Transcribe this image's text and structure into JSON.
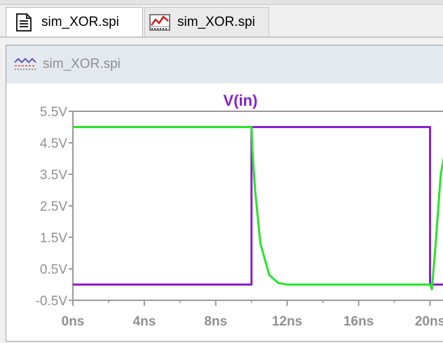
{
  "tabs": [
    {
      "label": "sim_XOR.spi",
      "icon": "netlist-document-icon",
      "active": true
    },
    {
      "label": "sim_XOR.spi",
      "icon": "waveform-icon",
      "active": false
    }
  ],
  "window": {
    "title": "sim_XOR.spi",
    "icon": "waveform-window-icon"
  },
  "colors": {
    "trace_in": "#8a1ed0",
    "trace_out": "#28e428",
    "axis": "#9a9a9a",
    "title": "#8a1ed0",
    "tick_label": "#909090"
  },
  "chart_data": {
    "type": "line",
    "title": "V(in)",
    "xlabel": "",
    "ylabel": "",
    "xlim": [
      0,
      21
    ],
    "ylim": [
      -0.5,
      5.5
    ],
    "x_ticks": [
      "0ns",
      "4ns",
      "8ns",
      "12ns",
      "16ns",
      "20ns"
    ],
    "x_tick_values": [
      0,
      4,
      8,
      12,
      16,
      20
    ],
    "y_ticks": [
      "5.5V",
      "4.5V",
      "3.5V",
      "2.5V",
      "1.5V",
      "0.5V",
      "-0.5V"
    ],
    "y_tick_values": [
      5.5,
      4.5,
      3.5,
      2.5,
      1.5,
      0.5,
      -0.5
    ],
    "grid": false,
    "series": [
      {
        "name": "V(in)",
        "color": "#8a1ed0",
        "x": [
          0,
          10,
          10,
          20,
          20,
          21
        ],
        "y": [
          0,
          0,
          5,
          5,
          0,
          0
        ]
      },
      {
        "name": "",
        "color": "#28e428",
        "x": [
          0,
          10,
          10.05,
          10.2,
          10.5,
          11.0,
          11.5,
          12,
          14,
          16,
          18,
          20,
          20.1,
          20.3,
          20.6,
          21
        ],
        "y": [
          5,
          5,
          4.3,
          3.0,
          1.3,
          0.3,
          0.05,
          0,
          0,
          0,
          0,
          0,
          -0.15,
          1.2,
          3.5,
          4.7
        ]
      }
    ]
  }
}
